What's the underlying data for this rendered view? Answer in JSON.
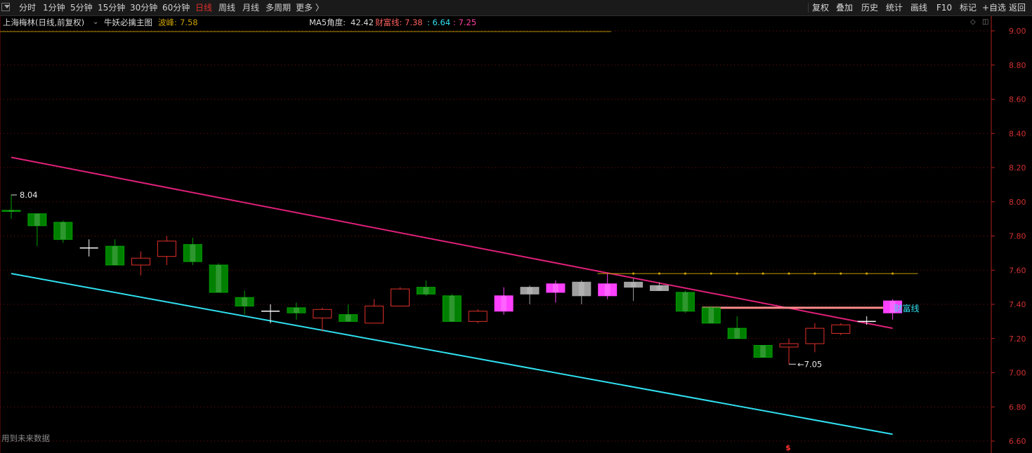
{
  "toolbar": {
    "periods": [
      "分时",
      "1分钟",
      "5分钟",
      "15分钟",
      "30分钟",
      "60分钟",
      "日线",
      "周线",
      "月线",
      "多周期",
      "更多 〉"
    ],
    "active_period": "日线",
    "right_buttons": [
      "复权",
      "叠加",
      "历史",
      "统计",
      "画线",
      "F10",
      "标记",
      "+自选",
      "返回"
    ]
  },
  "info": {
    "stock": "上海梅林(日线,前复权)",
    "indicator": "牛妖必擒主图",
    "wave_label": "波峰:",
    "wave_value": "7.58",
    "ma5_label": "MA5角度:",
    "ma5_value": "42.42",
    "wealth_label": "财富线:",
    "wealth_value": "7.38",
    "v2": ": 6.64",
    "v3": ": 7.25"
  },
  "annotations": {
    "high_label": "8.04",
    "low_label": "7.05",
    "wealth_line_label": "财富线",
    "footer": "用到未来数据",
    "marker": "$"
  },
  "colors": {
    "up": "#e0302a",
    "down": "#008000",
    "magenta": "#ff40ff",
    "gray": "#a0a0a0",
    "upper_channel": "#e0207a",
    "lower_channel": "#30e0f0",
    "wave_line": "#c8a000",
    "wealth_line": "#ff8c8c",
    "grid": "#7a1010"
  },
  "chart_data": {
    "type": "candlestick",
    "y_ticks": [
      9.0,
      8.8,
      8.6,
      8.4,
      8.2,
      8.0,
      7.8,
      7.6,
      7.4,
      7.2,
      7.0,
      6.8,
      6.6
    ],
    "ylim": [
      6.56,
      9.02
    ],
    "candles": [
      {
        "o": 7.95,
        "c": 7.95,
        "h": 8.04,
        "l": 7.9,
        "t": "down"
      },
      {
        "o": 7.93,
        "c": 7.86,
        "h": 7.93,
        "l": 7.74,
        "t": "down"
      },
      {
        "o": 7.88,
        "c": 7.78,
        "h": 7.89,
        "l": 7.76,
        "t": "down"
      },
      {
        "o": 7.73,
        "c": 7.73,
        "h": 7.78,
        "l": 7.68,
        "t": "doji"
      },
      {
        "o": 7.74,
        "c": 7.63,
        "h": 7.78,
        "l": 7.63,
        "t": "down"
      },
      {
        "o": 7.63,
        "c": 7.67,
        "h": 7.71,
        "l": 7.57,
        "t": "up"
      },
      {
        "o": 7.68,
        "c": 7.77,
        "h": 7.8,
        "l": 7.63,
        "t": "up"
      },
      {
        "o": 7.75,
        "c": 7.65,
        "h": 7.79,
        "l": 7.63,
        "t": "down"
      },
      {
        "o": 7.63,
        "c": 7.47,
        "h": 7.64,
        "l": 7.47,
        "t": "down"
      },
      {
        "o": 7.44,
        "c": 7.39,
        "h": 7.48,
        "l": 7.34,
        "t": "down"
      },
      {
        "o": 7.36,
        "c": 7.36,
        "h": 7.4,
        "l": 7.29,
        "t": "doji"
      },
      {
        "o": 7.38,
        "c": 7.35,
        "h": 7.41,
        "l": 7.31,
        "t": "down"
      },
      {
        "o": 7.32,
        "c": 7.37,
        "h": 7.38,
        "l": 7.24,
        "t": "up"
      },
      {
        "o": 7.34,
        "c": 7.3,
        "h": 7.4,
        "l": 7.3,
        "t": "down"
      },
      {
        "o": 7.29,
        "c": 7.39,
        "h": 7.43,
        "l": 7.29,
        "t": "up"
      },
      {
        "o": 7.39,
        "c": 7.49,
        "h": 7.5,
        "l": 7.39,
        "t": "up"
      },
      {
        "o": 7.5,
        "c": 7.46,
        "h": 7.54,
        "l": 7.45,
        "t": "down"
      },
      {
        "o": 7.45,
        "c": 7.3,
        "h": 7.46,
        "l": 7.3,
        "t": "down"
      },
      {
        "o": 7.3,
        "c": 7.36,
        "h": 7.37,
        "l": 7.29,
        "t": "up"
      },
      {
        "o": 7.36,
        "c": 7.45,
        "h": 7.5,
        "l": 7.34,
        "t": "magenta"
      },
      {
        "o": 7.5,
        "c": 7.46,
        "h": 7.51,
        "l": 7.4,
        "t": "gray"
      },
      {
        "o": 7.47,
        "c": 7.52,
        "h": 7.54,
        "l": 7.41,
        "t": "magenta"
      },
      {
        "o": 7.53,
        "c": 7.45,
        "h": 7.54,
        "l": 7.4,
        "t": "gray"
      },
      {
        "o": 7.45,
        "c": 7.52,
        "h": 7.58,
        "l": 7.43,
        "t": "magenta"
      },
      {
        "o": 7.53,
        "c": 7.5,
        "h": 7.55,
        "l": 7.42,
        "t": "gray"
      },
      {
        "o": 7.51,
        "c": 7.48,
        "h": 7.53,
        "l": 7.48,
        "t": "gray"
      },
      {
        "o": 7.47,
        "c": 7.36,
        "h": 7.48,
        "l": 7.35,
        "t": "down"
      },
      {
        "o": 7.38,
        "c": 7.29,
        "h": 7.39,
        "l": 7.29,
        "t": "down"
      },
      {
        "o": 7.26,
        "c": 7.2,
        "h": 7.33,
        "l": 7.2,
        "t": "down"
      },
      {
        "o": 7.16,
        "c": 7.09,
        "h": 7.16,
        "l": 7.09,
        "t": "down"
      },
      {
        "o": 7.15,
        "c": 7.17,
        "h": 7.2,
        "l": 7.05,
        "t": "up"
      },
      {
        "o": 7.17,
        "c": 7.26,
        "h": 7.29,
        "l": 7.12,
        "t": "up"
      },
      {
        "o": 7.23,
        "c": 7.28,
        "h": 7.29,
        "l": 7.22,
        "t": "up"
      },
      {
        "o": 7.3,
        "c": 7.3,
        "h": 7.33,
        "l": 7.28,
        "t": "doji"
      },
      {
        "o": 7.35,
        "c": 7.42,
        "h": 7.43,
        "l": 7.31,
        "t": "magenta"
      }
    ],
    "upper_channel": [
      [
        0,
        8.26
      ],
      [
        34,
        7.26
      ]
    ],
    "lower_channel": [
      [
        0,
        7.58
      ],
      [
        34,
        6.64
      ]
    ],
    "wave_line": {
      "value": 7.58,
      "from": 23,
      "to": 34
    },
    "wealth_line": {
      "value": 7.38,
      "from": 27,
      "to": 34
    }
  }
}
